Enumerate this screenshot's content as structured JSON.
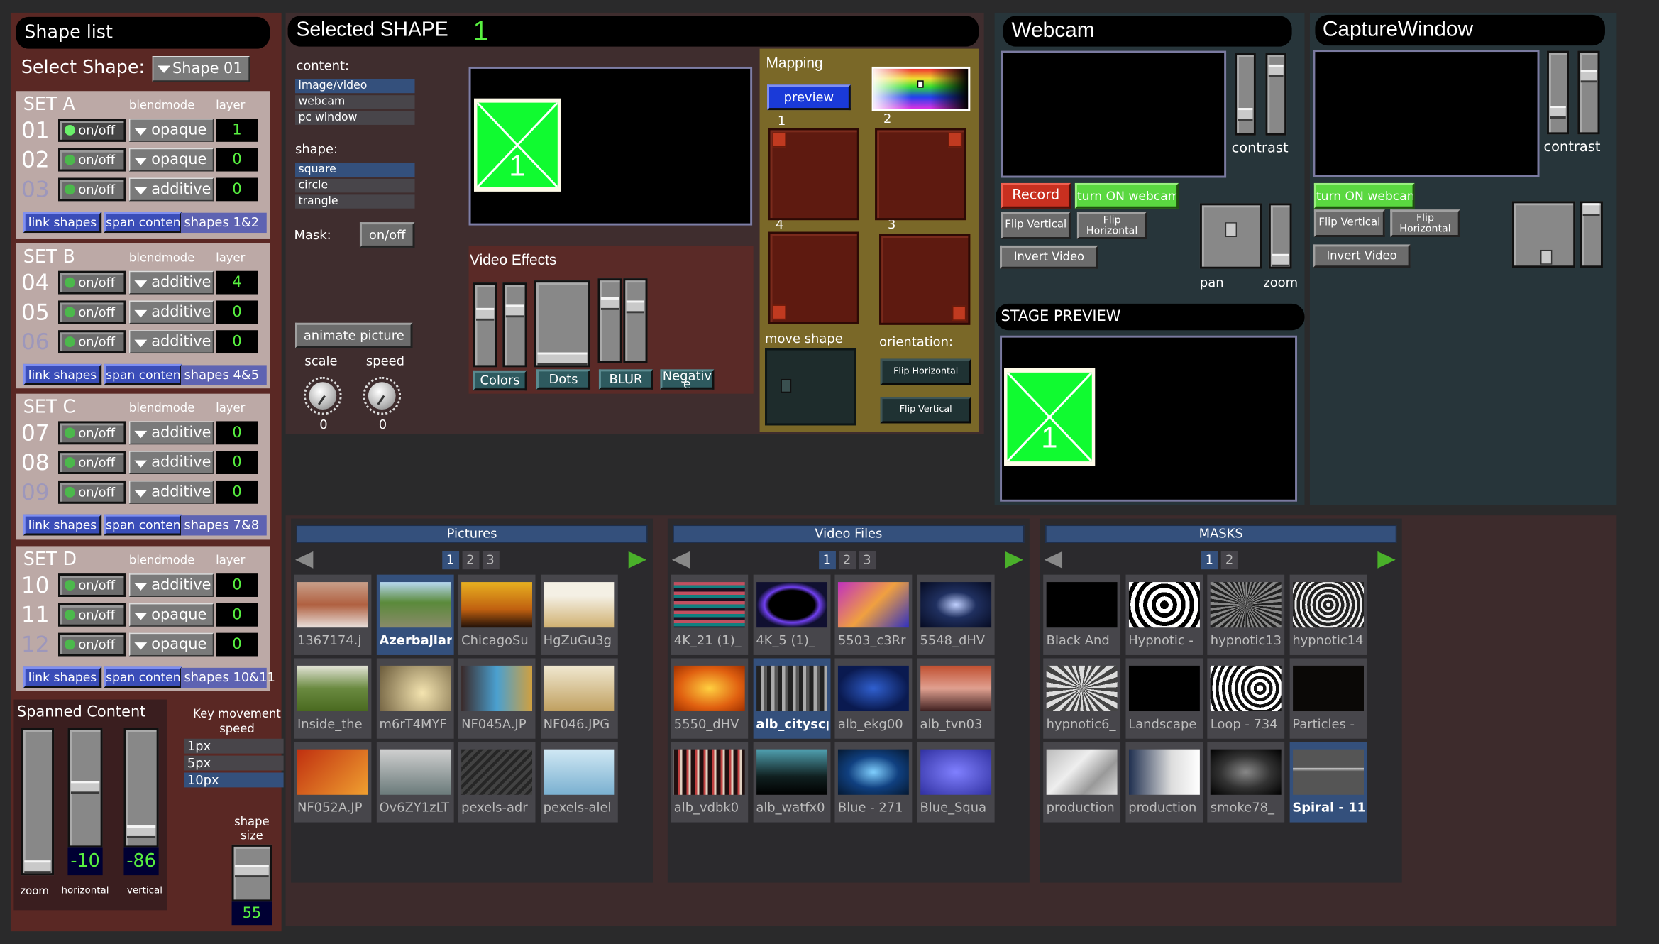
{
  "shape_list": {
    "title": "Shape list",
    "select_label": "Select Shape:",
    "select_value": "Shape 01",
    "sets": [
      {
        "title": "SET A",
        "blend_header": "blendmode",
        "layer_header": "layer",
        "link": "link shapes",
        "span": "span content",
        "span_label": "shapes 1&2",
        "rows": [
          {
            "num": "01",
            "toggle": "on/off",
            "blend": "opaque",
            "layer": "1",
            "on": true,
            "dim": false
          },
          {
            "num": "02",
            "toggle": "on/off",
            "blend": "opaque",
            "layer": "0",
            "on": false,
            "dim": false
          },
          {
            "num": "03",
            "toggle": "on/off",
            "blend": "additive",
            "layer": "0",
            "on": false,
            "dim": true
          }
        ]
      },
      {
        "title": "SET B",
        "blend_header": "blendmode",
        "layer_header": "layer",
        "link": "link shapes",
        "span": "span content",
        "span_label": "shapes 4&5",
        "rows": [
          {
            "num": "04",
            "toggle": "on/off",
            "blend": "additive",
            "layer": "4",
            "on": false,
            "dim": false
          },
          {
            "num": "05",
            "toggle": "on/off",
            "blend": "additive",
            "layer": "0",
            "on": false,
            "dim": false
          },
          {
            "num": "06",
            "toggle": "on/off",
            "blend": "additive",
            "layer": "0",
            "on": false,
            "dim": true
          }
        ]
      },
      {
        "title": "SET C",
        "blend_header": "blendmode",
        "layer_header": "layer",
        "link": "link shapes",
        "span": "span content",
        "span_label": "shapes 7&8",
        "rows": [
          {
            "num": "07",
            "toggle": "on/off",
            "blend": "additive",
            "layer": "0",
            "on": false,
            "dim": false
          },
          {
            "num": "08",
            "toggle": "on/off",
            "blend": "additive",
            "layer": "0",
            "on": false,
            "dim": false
          },
          {
            "num": "09",
            "toggle": "on/off",
            "blend": "additive",
            "layer": "0",
            "on": false,
            "dim": true
          }
        ]
      },
      {
        "title": "SET D",
        "blend_header": "blendmode",
        "layer_header": "layer",
        "link": "link shapes",
        "span": "span content",
        "span_label": "shapes 10&11",
        "rows": [
          {
            "num": "10",
            "toggle": "on/off",
            "blend": "additive",
            "layer": "0",
            "on": false,
            "dim": false
          },
          {
            "num": "11",
            "toggle": "on/off",
            "blend": "opaque",
            "layer": "0",
            "on": false,
            "dim": false
          },
          {
            "num": "12",
            "toggle": "on/off",
            "blend": "opaque",
            "layer": "0",
            "on": false,
            "dim": true
          }
        ]
      }
    ]
  },
  "spanned": {
    "title": "Spanned Content",
    "zoom_label": "zoom",
    "zoom_level": 0.0,
    "horizontal_label": "horizontal",
    "horizontal_value": "-10",
    "horizontal_level": 0.5,
    "vertical_label": "vertical",
    "vertical_value": "-86",
    "vertical_level": 0.07
  },
  "key_speed": {
    "label_line1": "Key movement",
    "label_line2": "speed",
    "options": [
      "1px",
      "5px",
      "10px"
    ],
    "selected": "10px"
  },
  "shape_size": {
    "label_line1": "shape",
    "label_line2": "size",
    "value": "55",
    "level": 0.55
  },
  "selected_shape": {
    "title": "Selected SHAPE",
    "number": "1",
    "content_label": "content:",
    "content_options": [
      "image/video",
      "webcam",
      "pc window"
    ],
    "content_selected": "image/video",
    "shape_label": "shape:",
    "shape_options": [
      "square",
      "circle",
      "trangle"
    ],
    "shape_selected": "square",
    "mask_label": "Mask:",
    "mask_toggle": "on/off",
    "animate": "animate picture",
    "scale_label": "scale",
    "scale_value": "0",
    "speed_label": "speed",
    "speed_value": "0",
    "preview_number": "1"
  },
  "video_effects": {
    "title": "Video Effects",
    "buttons": [
      "Colors",
      "Dots",
      "BLUR",
      "Negative"
    ],
    "slider_levels": [
      0.65,
      0.7,
      0.0,
      0.75,
      0.7
    ]
  },
  "mapping": {
    "title": "Mapping",
    "preview": "preview",
    "corners": [
      "1",
      "2",
      "4",
      "3"
    ],
    "move_label": "move shape",
    "orientation_label": "orientation:",
    "flip_h": "Flip Horizontal",
    "flip_v": "Flip Vertical"
  },
  "webcam": {
    "title": "Webcam",
    "contrast_label": "contrast",
    "contrast_levels": [
      0.2,
      0.85
    ],
    "record": "Record",
    "turn_on": "turn ON webcam",
    "flip_v": "Flip Vertical",
    "flip_h": "Flip Horizontal",
    "invert": "Invert Video",
    "pan_label": "pan",
    "zoom_label": "zoom",
    "zoom_level": 0.0
  },
  "stage_preview": {
    "title": "STAGE PREVIEW",
    "number": "1"
  },
  "capture": {
    "title": "CaptureWindow",
    "contrast_label": "contrast",
    "contrast_levels": [
      0.2,
      0.75
    ],
    "turn_on": "turn ON webcam",
    "flip_v": "Flip Vertical",
    "flip_h": "Flip Horizontal",
    "invert": "Invert Video",
    "zoom_level": 1.0
  },
  "colors": {
    "accent_green": "#58f040",
    "selection_blue": "#34507c",
    "record_red": "#c83020",
    "webcam_green": "#5ad840"
  },
  "browsers": [
    {
      "title": "Pictures",
      "pages": [
        "1",
        "2",
        "3"
      ],
      "current_page": "1",
      "items": [
        "1367174.j",
        "Azerbajian",
        "ChicagoSu",
        "HgZuGu3g",
        "Inside_the",
        "m6rT4MYF",
        "NF045A.JP",
        "NF046.JPG",
        "NF052A.JP",
        "Ov6ZY1zLT",
        "pexels-adr",
        "pexels-alel"
      ],
      "selected": "Azerbajian"
    },
    {
      "title": "Video Files",
      "pages": [
        "1",
        "2",
        "3"
      ],
      "current_page": "1",
      "items": [
        "4K_21 (1)_",
        "4K_5 (1)_",
        "5503_c3Rr",
        "5548_dHV",
        "5550_dHV",
        "alb_cityscp",
        "alb_ekg00",
        "alb_tvn03",
        "alb_vdbk0",
        "alb_watfx0",
        "Blue - 271",
        "Blue_Squa"
      ],
      "selected": "alb_cityscp"
    },
    {
      "title": "MASKS",
      "pages": [
        "1",
        "2"
      ],
      "current_page": "1",
      "items": [
        "Black And",
        "Hypnotic -",
        "hypnotic13",
        "hypnotic14",
        "hypnotic6_",
        "Landscape",
        "Loop - 734",
        "Particles -",
        "production",
        "production",
        "smoke78_",
        "Spiral - 11"
      ],
      "selected": "Spiral - 11"
    }
  ]
}
